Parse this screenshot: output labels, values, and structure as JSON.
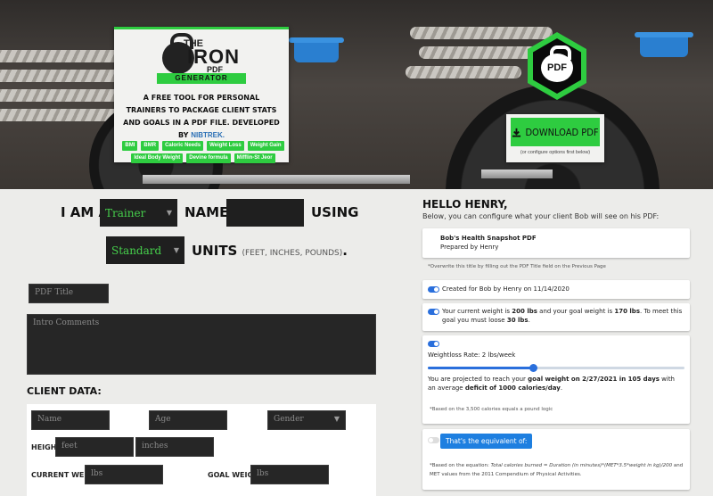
{
  "hero": {
    "logo": {
      "the": "THE",
      "iron": "IRON",
      "pdf": "PDF",
      "generator": "GENERATOR"
    },
    "description": "A FREE TOOL FOR PERSONAL TRAINERS TO PACKAGE CLIENT STATS AND GOALS IN A PDF FILE. DEVELOPED BY",
    "brand": "NIBTREK.",
    "tags": [
      "BMI",
      "BMR",
      "Caloric Needs",
      "Weight Loss",
      "Weight Gain",
      "Ideal Body Weight",
      "Devine formula",
      "Mifflin-St Jeor"
    ],
    "pdf_badge": "PDF",
    "download_label": "DOWNLOAD PDF",
    "download_note": "(or configure options first below)"
  },
  "intro": {
    "i_am_a": "I AM A",
    "role": "Trainer",
    "named": "NAMED",
    "using": "USING",
    "units_value": "Standard",
    "units_word": "UNITS",
    "units_note": "(FEET, INCHES, POUNDS)",
    "period": "."
  },
  "form": {
    "pdf_title_placeholder": "PDF Title",
    "intro_comments_placeholder": "Intro Comments",
    "client_data_label": "CLIENT DATA:",
    "name_placeholder": "Name",
    "age_placeholder": "Age",
    "gender_placeholder": "Gender",
    "height_label": "HEIGHT:",
    "feet_placeholder": "feet",
    "inches_placeholder": "inches",
    "current_weight_label": "CURRENT WEIGHT:",
    "current_weight_placeholder": "lbs",
    "goal_weight_label": "GOAL WEIGHT:",
    "goal_weight_placeholder": "lbs"
  },
  "right": {
    "hello": "HELLO HENRY,",
    "subtitle": "Below, you can configure what your client Bob will see on his PDF:",
    "title_card": {
      "title": "Bob's Health Snapshot PDF",
      "prepared": "Prepared by Henry"
    },
    "title_note": "*Overwrite this title by filling out the PDF Title field on the Previous Page",
    "created": "Created for Bob by Henry on 11/14/2020",
    "weight_goal": {
      "pre": "Your current weight is ",
      "current": "200 lbs",
      "mid": " and your goal weight is ",
      "goal": "170 lbs",
      "post": ". To meet this goal you must loose ",
      "loss": "30 lbs",
      "end": "."
    },
    "rate": {
      "label_pre": "Weightloss Rate: ",
      "label_val": "2 lbs/week",
      "slider_fraction": 0.41,
      "proj_pre": "You are projected to reach your ",
      "proj_goal": "goal weight on 2/27/2021 in 105 days",
      "proj_mid": " with an average ",
      "proj_deficit": "deficit of 1000 calories/day",
      "proj_end": ".",
      "note": "*Based on the 3,500 calories equals a pound logic"
    },
    "equivalent": {
      "button": "That's the equivalent of:",
      "note_pre": "*Based on the equation: ",
      "note_eq": "Total calories burned = Duration (in minutes)*(MET*3.5*weight in kg)/200",
      "note_post": " and MET values from the 2011 Compendium of Physical Activities."
    }
  },
  "colors": {
    "accent_green": "#2ecc40",
    "toggle_blue": "#2a6fdc",
    "dark_field": "#1f1f1f"
  }
}
